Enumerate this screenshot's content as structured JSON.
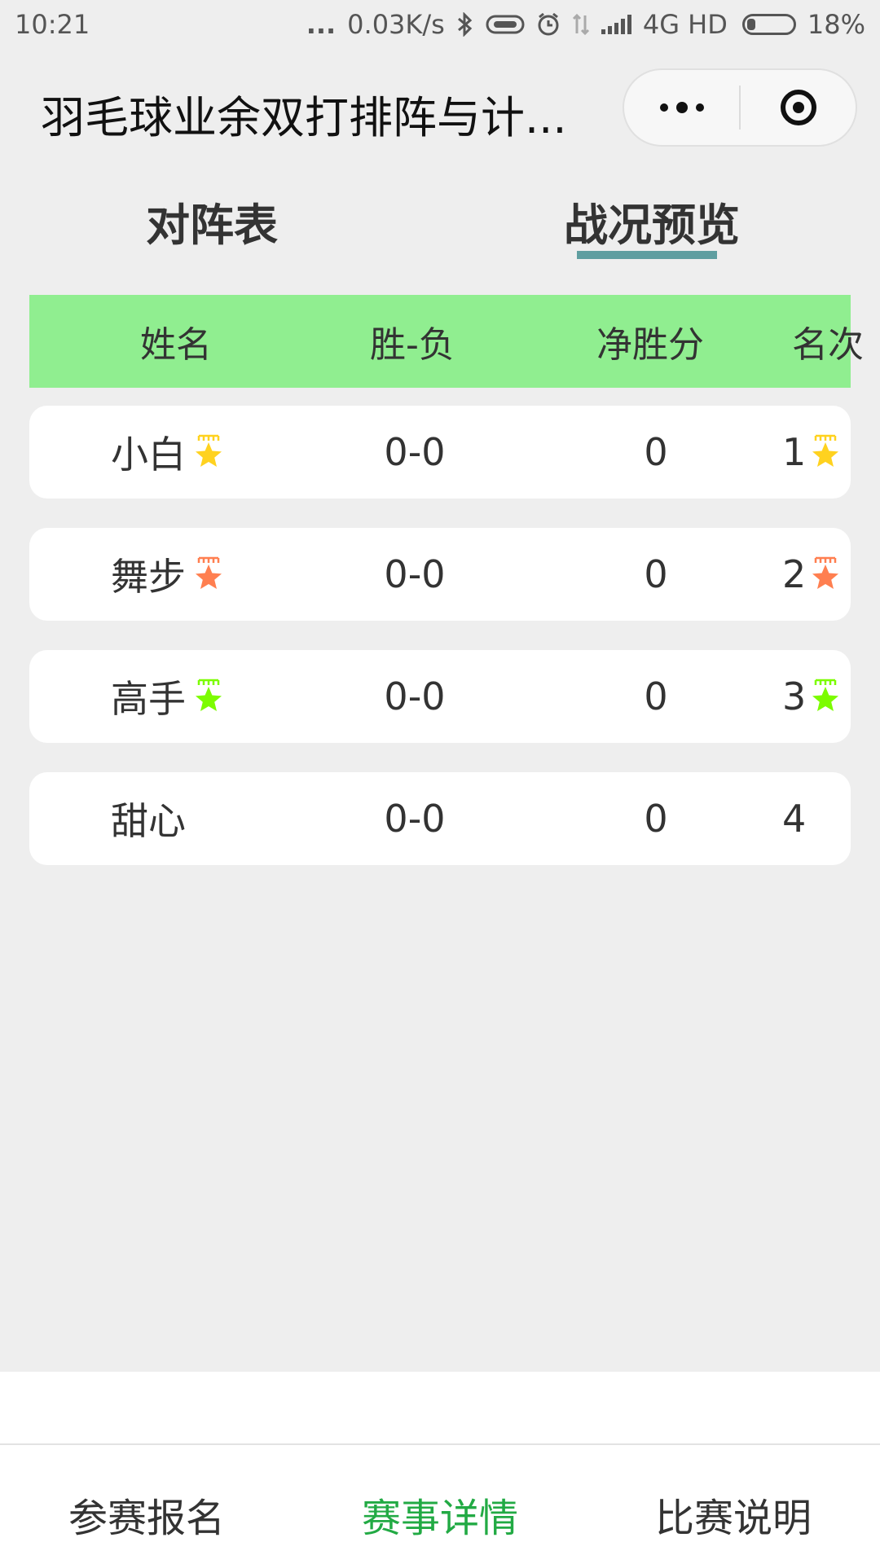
{
  "status_bar": {
    "time": "10:21",
    "dots": "...",
    "speed": "0.03K/s",
    "network": "4G HD",
    "battery": "18%"
  },
  "header": {
    "title": "羽毛球业余双打排阵与计..."
  },
  "tabs": [
    {
      "label": "对阵表",
      "active": false
    },
    {
      "label": "战况预览",
      "active": true
    }
  ],
  "table": {
    "headers": [
      "姓名",
      "胜-负",
      "净胜分",
      "名次"
    ],
    "rows": [
      {
        "name": "小白",
        "wl": "0-0",
        "net": "0",
        "rank": "1",
        "medal_color": "#ffd21f"
      },
      {
        "name": "舞步",
        "wl": "0-0",
        "net": "0",
        "rank": "2",
        "medal_color": "#ff7f50"
      },
      {
        "name": "高手",
        "wl": "0-0",
        "net": "0",
        "rank": "3",
        "medal_color": "#7cfc00"
      },
      {
        "name": "甜心",
        "wl": "0-0",
        "net": "0",
        "rank": "4",
        "medal_color": ""
      }
    ]
  },
  "bottom_nav": [
    {
      "label": "参赛报名",
      "active": false
    },
    {
      "label": "赛事详情",
      "active": true
    },
    {
      "label": "比赛说明",
      "active": false
    }
  ],
  "colors": {
    "header_bg": "#90ee90",
    "tab_underline": "#5f9ea0",
    "nav_active": "#22aa44"
  }
}
